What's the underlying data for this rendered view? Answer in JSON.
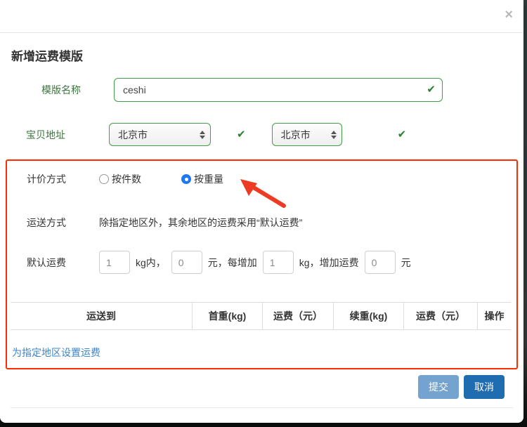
{
  "modal": {
    "title": "新增运费模版",
    "icons": {
      "close": "×",
      "check": "✔"
    },
    "form": {
      "template_name": {
        "label": "模版名称",
        "value": "ceshi"
      },
      "item_address": {
        "label": "宝贝地址",
        "province_selected": "北京市",
        "city_selected": "北京市"
      },
      "pricing_method": {
        "label": "计价方式",
        "options": [
          {
            "label": "按件数",
            "selected": false
          },
          {
            "label": "按重量",
            "selected": true
          }
        ]
      },
      "shipping_method": {
        "label": "运送方式",
        "text": "除指定地区外，其余地区的运费采用“默认运费”"
      },
      "default_fee": {
        "label": "默认运费",
        "first_weight": "1",
        "sep1": "kg内，",
        "first_fee": "0",
        "sep2": "元，每增加",
        "add_weight": "1",
        "sep3": "kg，增加运费",
        "add_fee": "0",
        "sep4": "元"
      }
    },
    "table": {
      "headers": [
        "运送到",
        "首重(kg)",
        "运费（元）",
        "续重(kg)",
        "运费（元）",
        "操作"
      ],
      "rows": []
    },
    "link_set_region_fee": "为指定地区设置运费",
    "buttons": {
      "submit": "提交",
      "cancel": "取消"
    }
  },
  "colors": {
    "success_green": "#3c763d",
    "check_green": "#2e7d32",
    "highlight_red": "#fe2c00",
    "radio_blue": "#2077f3",
    "link_blue": "#3c85c8",
    "submit_blue": "#73a3ce",
    "cancel_blue": "#1f6cb0"
  }
}
